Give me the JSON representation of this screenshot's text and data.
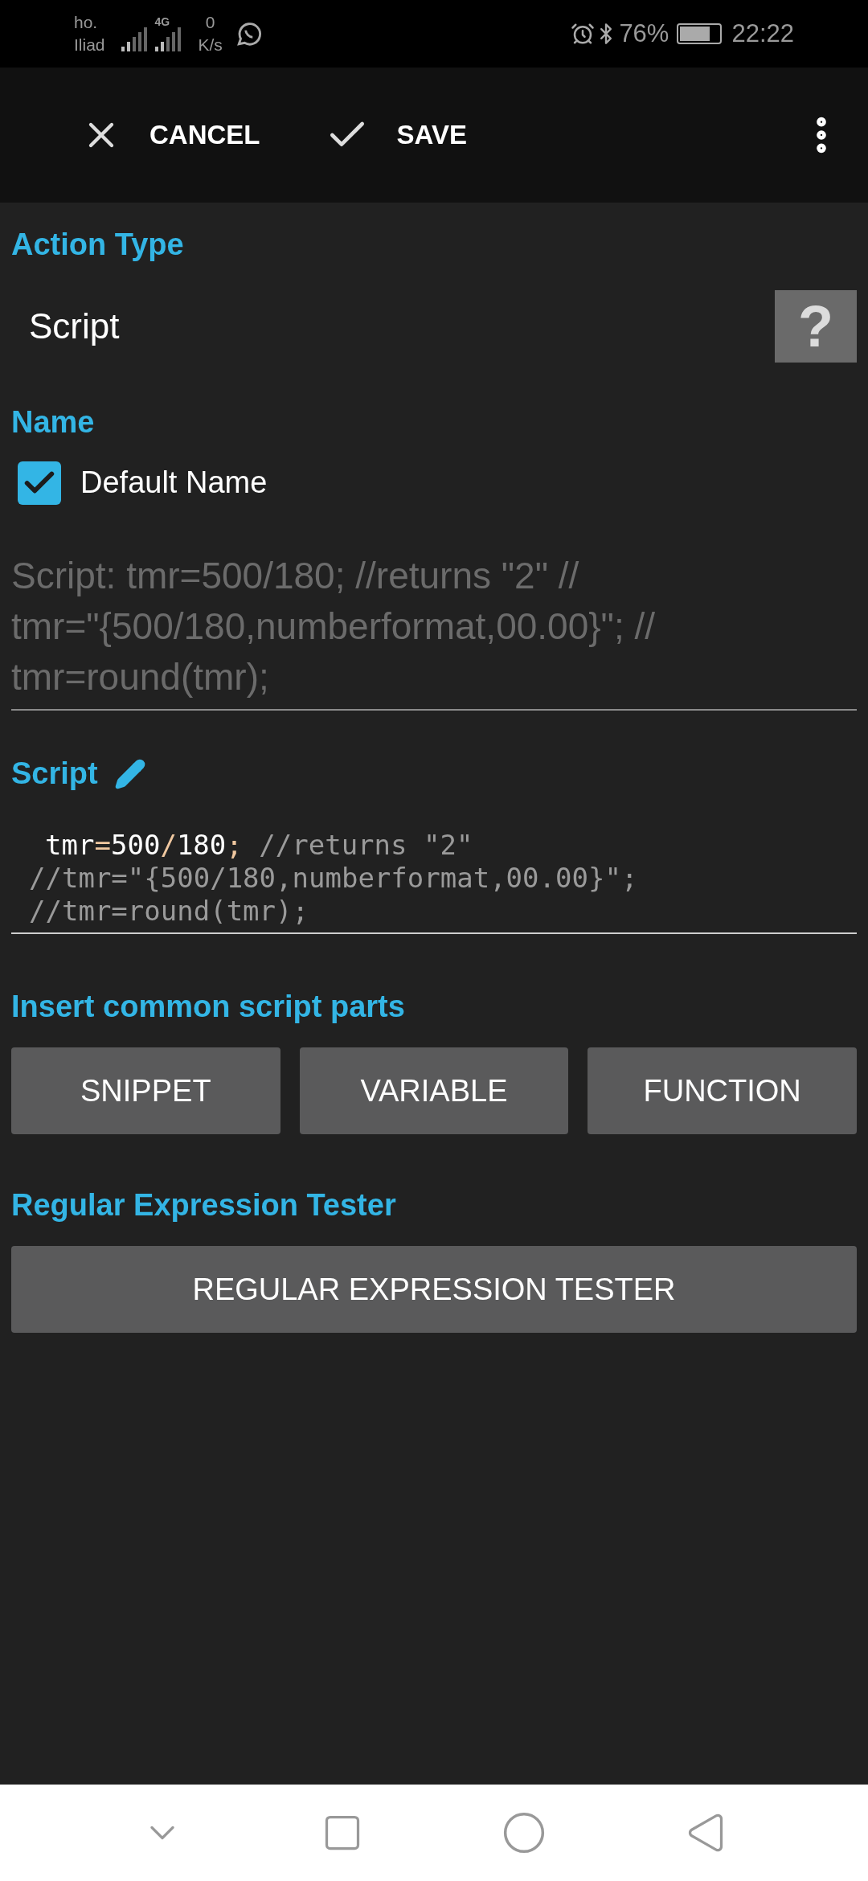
{
  "status_bar": {
    "carrier_top": "ho.",
    "carrier_bottom": "Iliad",
    "network": "4G",
    "speed_value": "0",
    "speed_unit": "K/s",
    "battery": "76%",
    "time": "22:22"
  },
  "toolbar": {
    "cancel": "CANCEL",
    "save": "SAVE"
  },
  "action_type": {
    "label": "Action Type",
    "value": "Script",
    "help": "?"
  },
  "name": {
    "label": "Name",
    "checkbox_label": "Default Name",
    "checked": true,
    "lines": [
      "Script: tmr=500/180; //returns \"2\" //",
      "tmr=\"{500/180,numberformat,00.00}\"; //",
      "tmr=round(tmr);"
    ]
  },
  "script": {
    "label": "Script",
    "lines": [
      {
        "indent": true,
        "segments": [
          {
            "kind": "code",
            "text": "tmr=500/180;"
          },
          {
            "kind": "comment",
            "text": " //returns \"2\""
          }
        ]
      },
      {
        "indent": false,
        "segments": [
          {
            "kind": "comment",
            "text": "//tmr=\"{500/180,numberformat,00.00}\";"
          }
        ]
      },
      {
        "indent": false,
        "segments": [
          {
            "kind": "comment",
            "text": "//tmr=round(tmr);"
          }
        ]
      }
    ]
  },
  "insert": {
    "label": "Insert common script parts",
    "buttons": [
      "SNIPPET",
      "VARIABLE",
      "FUNCTION"
    ]
  },
  "regex": {
    "label": "Regular Expression Tester",
    "button": "REGULAR EXPRESSION TESTER"
  }
}
